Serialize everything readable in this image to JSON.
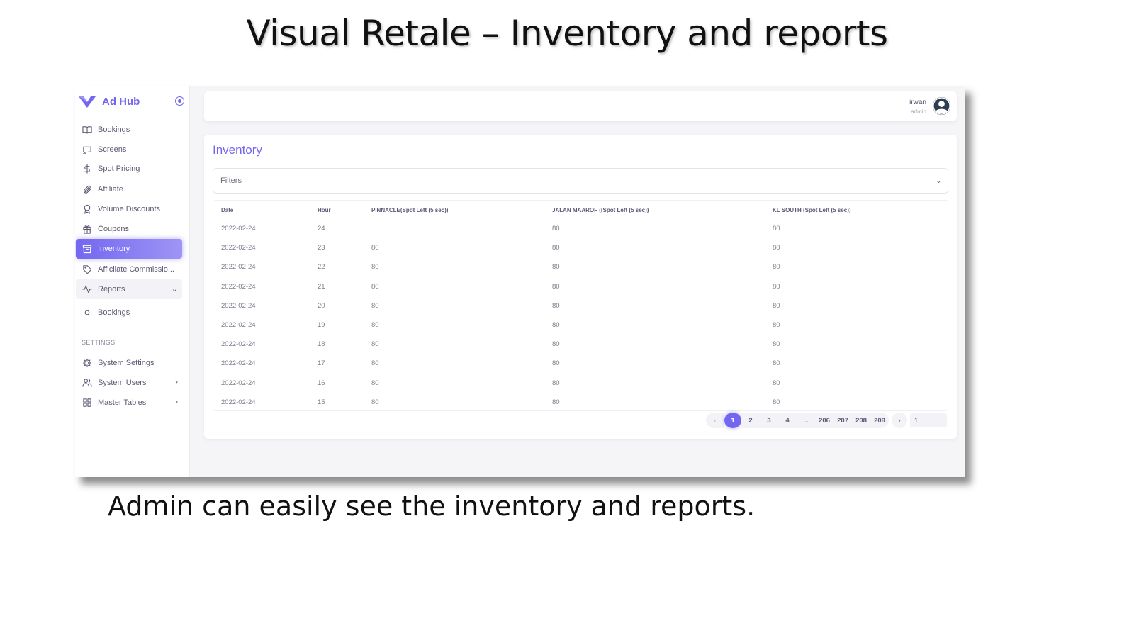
{
  "slide": {
    "title": "Visual Retale – Inventory and reports",
    "caption": "Admin can easily see the inventory and reports."
  },
  "brand": {
    "name": "Ad Hub",
    "accent": "#7367f0"
  },
  "sidebar": {
    "items": [
      {
        "label": "Bookings",
        "icon": "book-open-icon"
      },
      {
        "label": "Screens",
        "icon": "screen-cast-icon"
      },
      {
        "label": "Spot Pricing",
        "icon": "dollar-icon"
      },
      {
        "label": "Affiliate",
        "icon": "paperclip-icon"
      },
      {
        "label": "Volume Discounts",
        "icon": "award-icon"
      },
      {
        "label": "Coupons",
        "icon": "gift-icon"
      },
      {
        "label": "Inventory",
        "icon": "archive-icon",
        "active": true
      },
      {
        "label": "Afficilate Commissio...",
        "icon": "tag-icon"
      },
      {
        "label": "Reports",
        "icon": "activity-icon",
        "expanded": true
      },
      {
        "label": "Bookings",
        "icon": "circle-icon"
      }
    ],
    "settings_label": "SETTINGS",
    "settings_items": [
      {
        "label": "System Settings",
        "icon": "settings-icon"
      },
      {
        "label": "System Users",
        "icon": "users-icon"
      },
      {
        "label": "Master Tables",
        "icon": "grid-icon"
      }
    ]
  },
  "user": {
    "name": "irwan",
    "role": "admin"
  },
  "inventory": {
    "title": "Inventory",
    "filters_label": "Filters",
    "columns": [
      "Date",
      "Hour",
      "PINNACLE(Spot Left (5 sec))",
      "JALAN MAAROF ((Spot Left (5 sec))",
      "KL SOUTH (Spot Left (5 sec))"
    ],
    "rows": [
      [
        "2022-02-24",
        "24",
        "",
        "80",
        "80"
      ],
      [
        "2022-02-24",
        "23",
        "80",
        "80",
        "80"
      ],
      [
        "2022-02-24",
        "22",
        "80",
        "80",
        "80"
      ],
      [
        "2022-02-24",
        "21",
        "80",
        "80",
        "80"
      ],
      [
        "2022-02-24",
        "20",
        "80",
        "80",
        "80"
      ],
      [
        "2022-02-24",
        "19",
        "80",
        "80",
        "80"
      ],
      [
        "2022-02-24",
        "18",
        "80",
        "80",
        "80"
      ],
      [
        "2022-02-24",
        "17",
        "80",
        "80",
        "80"
      ],
      [
        "2022-02-24",
        "16",
        "80",
        "80",
        "80"
      ],
      [
        "2022-02-24",
        "15",
        "80",
        "80",
        "80"
      ]
    ]
  },
  "pagination": {
    "prev": "‹",
    "pages": [
      "1",
      "2",
      "3",
      "4",
      "...",
      "206",
      "207",
      "208",
      "209"
    ],
    "current": "1",
    "next": "›",
    "goto_value": "1"
  }
}
